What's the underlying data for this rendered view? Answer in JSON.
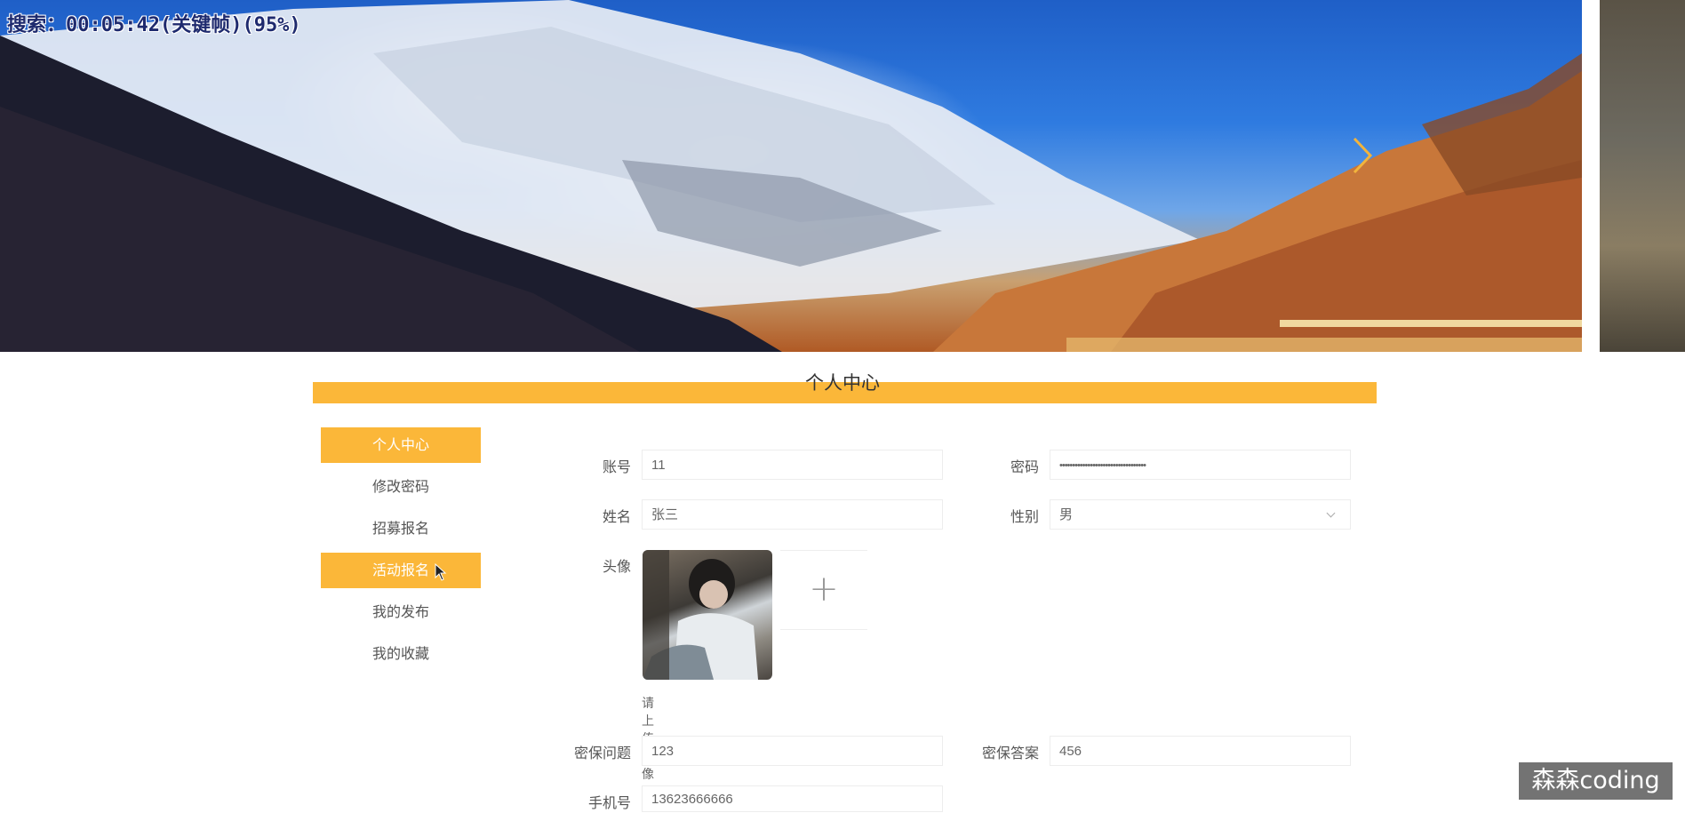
{
  "overlay": {
    "text": "搜索：00:05:42(关键帧)(95%)"
  },
  "section": {
    "title": "个人中心"
  },
  "menu": {
    "items": [
      {
        "label": "个人中心",
        "active": true
      },
      {
        "label": "修改密码",
        "active": false
      },
      {
        "label": "招募报名",
        "active": false
      },
      {
        "label": "活动报名",
        "active": true
      },
      {
        "label": "我的发布",
        "active": false
      },
      {
        "label": "我的收藏",
        "active": false
      }
    ]
  },
  "form": {
    "account": {
      "label": "账号",
      "value": "11"
    },
    "password": {
      "label": "密码",
      "value": "••••••••••••••••••••••••••••••••••"
    },
    "name": {
      "label": "姓名",
      "value": "张三"
    },
    "gender": {
      "label": "性别",
      "value": "男"
    },
    "avatar": {
      "label": "头像",
      "hint": "请上传头像",
      "plus": "+"
    },
    "security_question": {
      "label": "密保问题",
      "value": "123"
    },
    "security_answer": {
      "label": "密保答案",
      "value": "456"
    },
    "phone": {
      "label": "手机号",
      "value": "13623666666"
    }
  },
  "watermark": {
    "text": "森森coding"
  },
  "colors": {
    "accent": "#fbb739"
  }
}
